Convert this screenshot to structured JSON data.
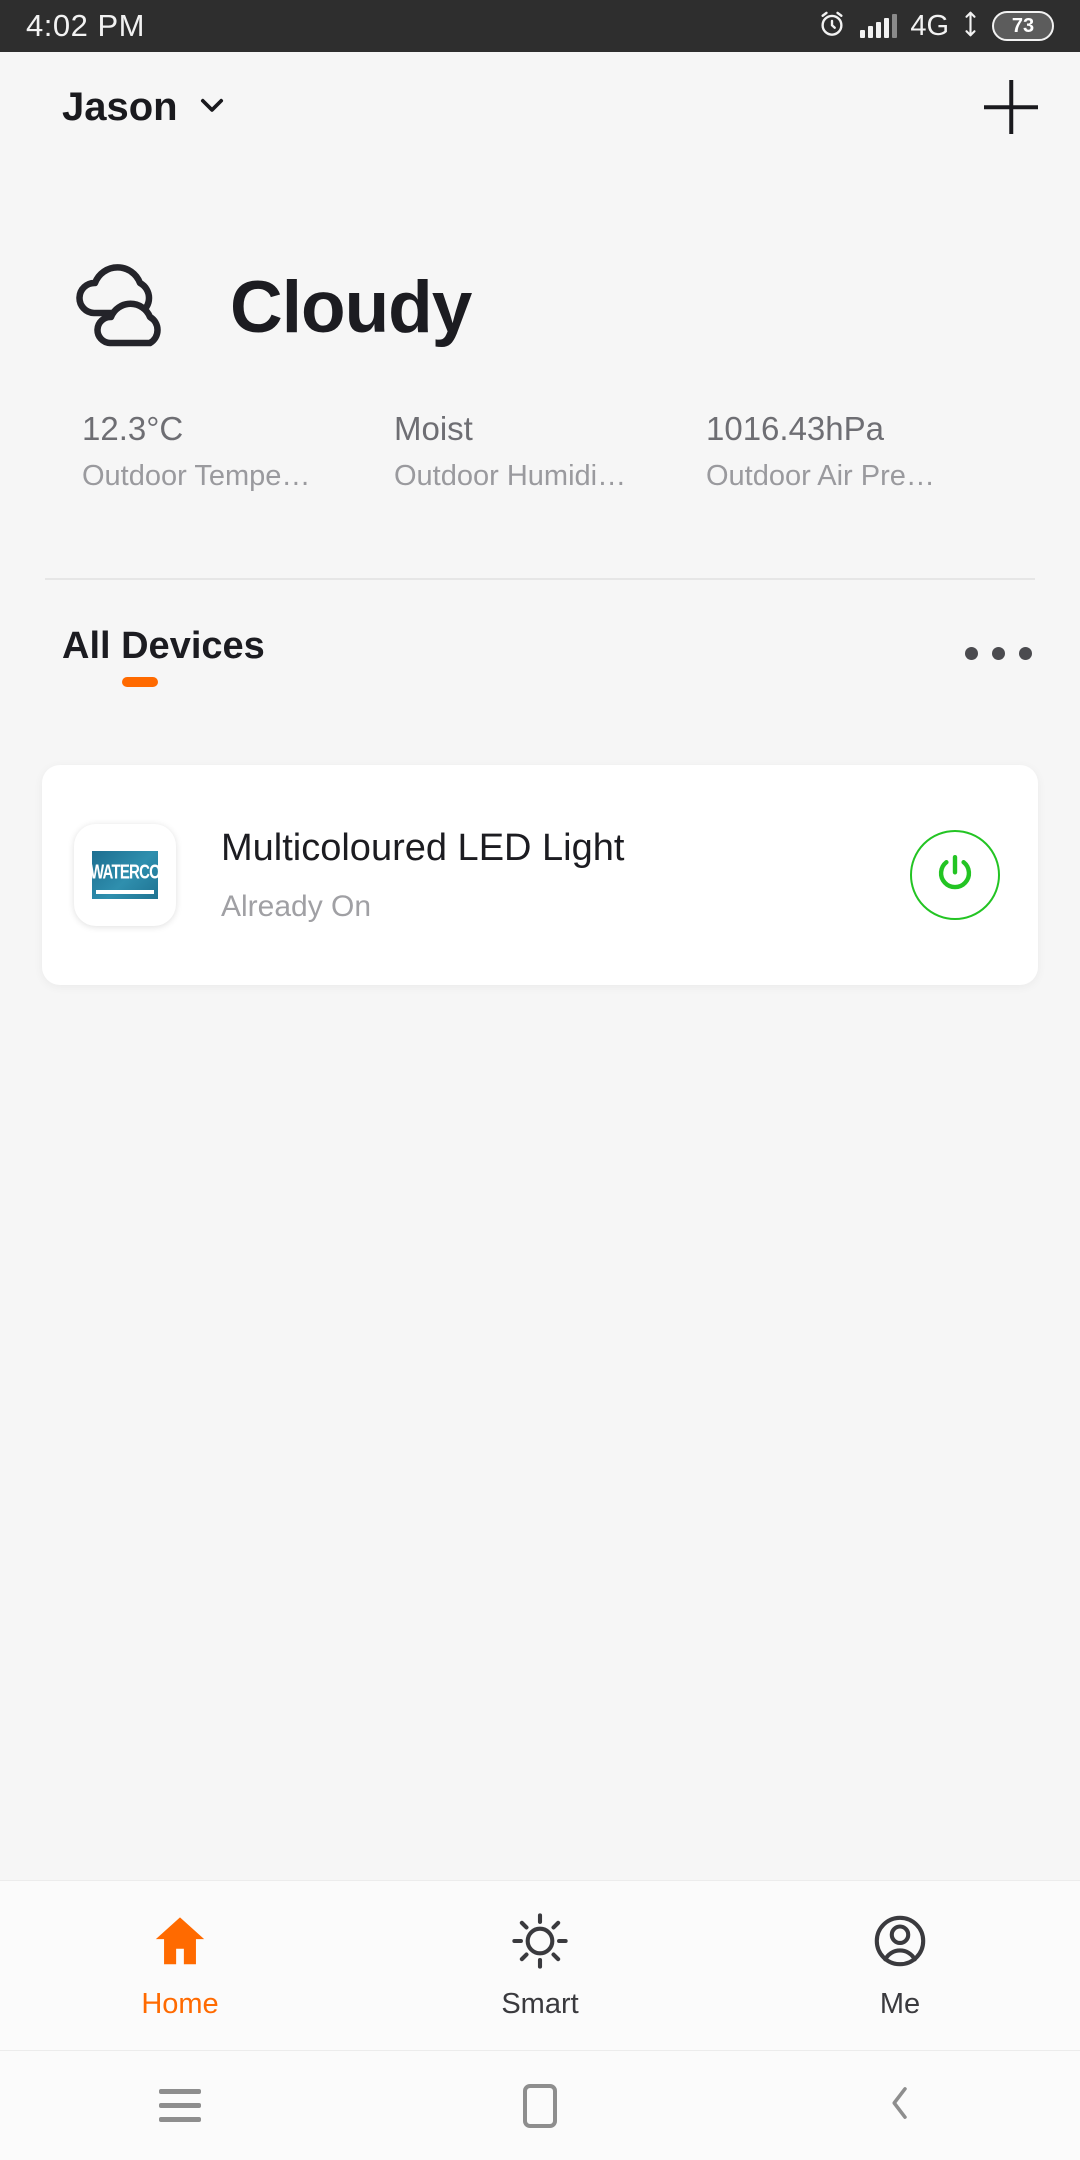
{
  "statusbar": {
    "time": "4:02 PM",
    "alarm_icon": "alarm-clock-icon",
    "signal_icon": "signal-bars-icon",
    "network": "4G",
    "data_icon": "data-transfer-icon",
    "battery_level": "73"
  },
  "appbar": {
    "home_name": "Jason",
    "chevron_icon": "chevron-down-icon",
    "add_icon": "plus-icon"
  },
  "weather": {
    "icon": "cloud-icon",
    "condition": "Cloudy",
    "stats": [
      {
        "value": "12.3°C",
        "label": "Outdoor Tempe…"
      },
      {
        "value": "Moist",
        "label": "Outdoor Humidi…"
      },
      {
        "value": "1016.43hPa",
        "label": "Outdoor Air Pre…"
      }
    ]
  },
  "tabs": {
    "items": [
      {
        "label": "All Devices",
        "active": true
      }
    ],
    "overflow_icon": "more-horizontal-icon",
    "accent_color": "#ff6a00"
  },
  "devices": [
    {
      "brand_logo_text": "WATERCO",
      "name": "Multicoloured LED Light",
      "status": "Already On",
      "power_icon": "power-icon",
      "power_color": "#23c423"
    }
  ],
  "bottom_nav": [
    {
      "label": "Home",
      "icon": "house-icon",
      "active": true
    },
    {
      "label": "Smart",
      "icon": "brightness-sun-icon",
      "active": false
    },
    {
      "label": "Me",
      "icon": "person-circle-icon",
      "active": false
    }
  ],
  "system_nav": {
    "recents_icon": "hamburger-menu-icon",
    "home_icon": "square-home-icon",
    "back_icon": "chevron-left-back-icon"
  }
}
